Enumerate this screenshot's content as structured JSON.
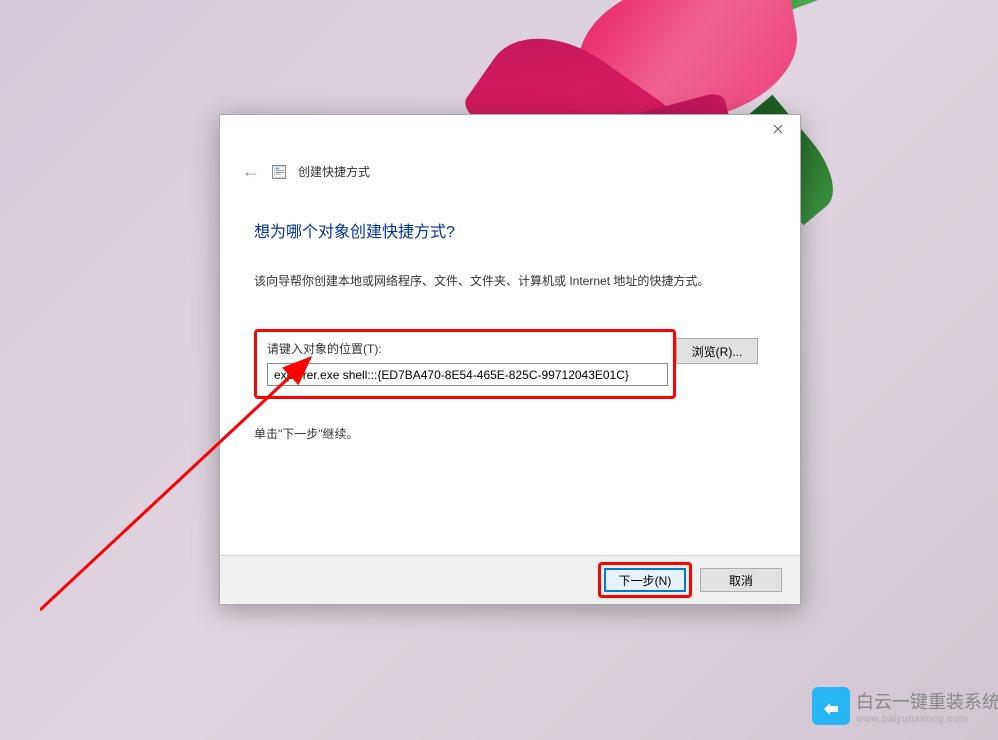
{
  "wizard": {
    "title": "创建快捷方式",
    "heading": "想为哪个对象创建快捷方式?",
    "description": "该向导帮你创建本地或网络程序、文件、文件夹、计算机或 Internet 地址的快捷方式。",
    "location_label": "请键入对象的位置(T):",
    "location_value": "explorer.exe shell:::{ED7BA470-8E54-465E-825C-99712043E01C}",
    "browse_label": "浏览(R)...",
    "continue_text": "单击\"下一步\"继续。",
    "next_label": "下一步(N)",
    "cancel_label": "取消"
  },
  "watermark": {
    "brand": "白云一键重装系统",
    "url": "www.baiyunxitong.com"
  }
}
